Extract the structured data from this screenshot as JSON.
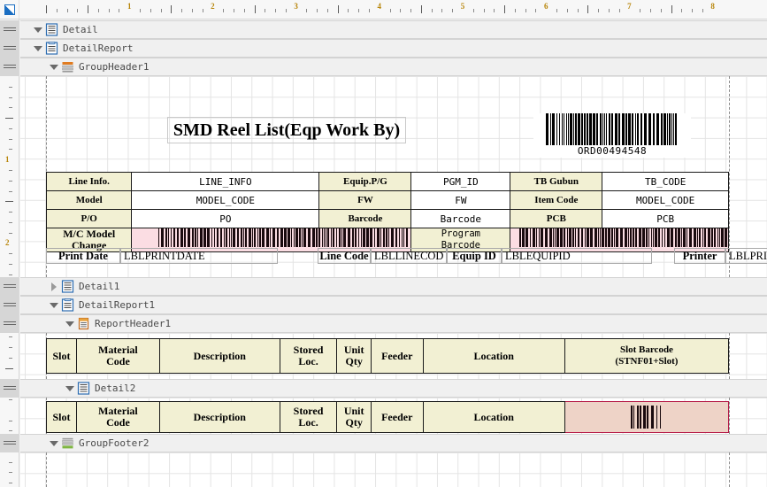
{
  "ruler": {
    "h_numbers": [
      "1",
      "2",
      "3",
      "4",
      "5",
      "6",
      "7",
      "8"
    ],
    "v_numbers": [
      "1",
      "2"
    ],
    "unit": "inch"
  },
  "bands": [
    {
      "id": "detail",
      "label": "Detail",
      "icon": "detail-section-icon",
      "expanded": true,
      "indent": 0
    },
    {
      "id": "detailreport",
      "label": "DetailReport",
      "icon": "detail-report-icon",
      "expanded": true,
      "indent": 0
    },
    {
      "id": "groupheader1",
      "label": "GroupHeader1",
      "icon": "group-header-icon",
      "expanded": true,
      "indent": 1
    },
    {
      "id": "detail1",
      "label": "Detail1",
      "icon": "detail-section-icon",
      "expanded": false,
      "indent": 1
    },
    {
      "id": "detailreport1",
      "label": "DetailReport1",
      "icon": "detail-report-icon",
      "expanded": true,
      "indent": 1
    },
    {
      "id": "reportheader1",
      "label": "ReportHeader1",
      "icon": "report-header-icon",
      "expanded": true,
      "indent": 2
    },
    {
      "id": "detail2",
      "label": "Detail2",
      "icon": "detail-section-icon",
      "expanded": true,
      "indent": 2
    },
    {
      "id": "groupfooter2",
      "label": "GroupFooter2",
      "icon": "group-footer-icon",
      "expanded": true,
      "indent": 1
    }
  ],
  "report": {
    "title": "SMD Reel List(Eqp Work By)",
    "header_barcode": {
      "name": "order-barcode",
      "text": "ORD00494548"
    },
    "info_table": {
      "rows": [
        [
          {
            "kind": "label",
            "text": "Line Info."
          },
          {
            "kind": "value",
            "text": "LINE_INFO"
          },
          {
            "kind": "label",
            "text": "Equip.P/G"
          },
          {
            "kind": "value",
            "text": "PGM_ID"
          },
          {
            "kind": "label",
            "text": "TB Gubun"
          },
          {
            "kind": "value",
            "text": "TB_CODE"
          }
        ],
        [
          {
            "kind": "label",
            "text": "Model"
          },
          {
            "kind": "value",
            "text": "MODEL_CODE"
          },
          {
            "kind": "label",
            "text": "FW"
          },
          {
            "kind": "value",
            "text": "FW"
          },
          {
            "kind": "label",
            "text": "Item Code"
          },
          {
            "kind": "value",
            "text": "MODEL_CODE"
          }
        ],
        [
          {
            "kind": "label",
            "text": "P/O"
          },
          {
            "kind": "value",
            "text": "PO"
          },
          {
            "kind": "label",
            "text": "Barcode"
          },
          {
            "kind": "value",
            "text": "Barcode"
          },
          {
            "kind": "label",
            "text": "PCB"
          },
          {
            "kind": "value",
            "text": "PCB"
          }
        ],
        [
          {
            "kind": "label",
            "text": "M/C Model Change"
          },
          {
            "kind": "barcode",
            "text": ""
          },
          {
            "kind": "label",
            "text": "Program Barcode"
          },
          {
            "kind": "barcode",
            "text": ""
          }
        ]
      ]
    },
    "footer_fields": [
      {
        "label": "Print Date",
        "value": "LBLPRINTDATE"
      },
      {
        "label": "Line Code",
        "value": "LBLLINECOD"
      },
      {
        "label": "Equip ID",
        "value": "LBLEQUIPID"
      },
      {
        "label": "Printer",
        "value": "LBLPRI"
      }
    ],
    "slot_table": {
      "headers": [
        "Slot",
        "Material Code",
        "Description",
        "Stored Loc.",
        "Unit Qty",
        "Feeder",
        "Location",
        "Slot Barcode (STNF01+Slot)"
      ],
      "headers_multiline": [
        [
          "Slot"
        ],
        [
          "Material",
          "Code"
        ],
        [
          "Description"
        ],
        [
          "Stored",
          "Loc."
        ],
        [
          "Unit",
          "Qty"
        ],
        [
          "Feeder"
        ],
        [
          "Location"
        ],
        [
          "Slot Barcode",
          "(STNF01+Slot)"
        ]
      ],
      "detail_row": [
        [
          "Slot"
        ],
        [
          "Material",
          "Code"
        ],
        [
          "Description"
        ],
        [
          "Stored",
          "Loc."
        ],
        [
          "Unit",
          "Qty"
        ],
        [
          "Feeder"
        ],
        [
          "Location"
        ],
        [
          "__barcode__"
        ]
      ]
    }
  },
  "colors": {
    "label_bg": "#f2f0d3",
    "barcode_bg_pink": "#fbdde3",
    "barcode_bg_peach": "#eed3c7",
    "barcode_border": "#b51946",
    "cell_border": "#1a1a1a",
    "band_bg": "#f0f0f0",
    "canvas_bg": "#ffffff",
    "ruler_number": "#b8860b"
  }
}
